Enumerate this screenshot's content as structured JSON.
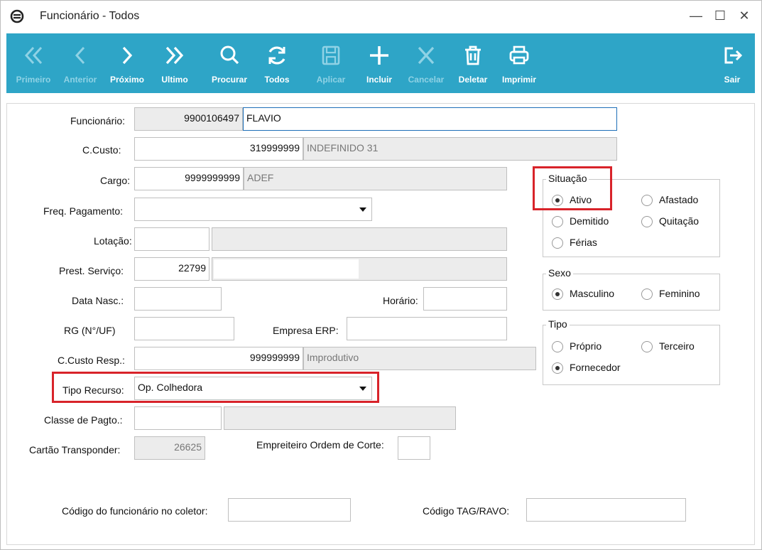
{
  "window": {
    "title": "Funcionário - Todos",
    "minimize": "—",
    "maximize": "☐",
    "close": "✕"
  },
  "toolbar": {
    "first": "Primeiro",
    "previous": "Anterior",
    "next": "Próximo",
    "last": "Ultimo",
    "search": "Procurar",
    "all": "Todos",
    "apply": "Aplicar",
    "add": "Incluir",
    "cancel": "Cancelar",
    "delete": "Deletar",
    "print": "Imprimir",
    "exit": "Sair"
  },
  "form": {
    "funcionario": {
      "label": "Funcionário:",
      "code": "9900106497",
      "name": "FLAVIO"
    },
    "ccusto": {
      "label": "C.Custo:",
      "code": "319999999",
      "desc": "INDEFINIDO 31"
    },
    "cargo": {
      "label": "Cargo:",
      "code": "9999999999",
      "desc": "ADEF"
    },
    "freq_pagamento": {
      "label": "Freq. Pagamento:",
      "value": ""
    },
    "lotacao": {
      "label": "Lotação:",
      "code": "",
      "desc": ""
    },
    "prest_servico": {
      "label": "Prest. Serviço:",
      "code": "22799",
      "desc": ""
    },
    "data_nasc": {
      "label": "Data Nasc.:",
      "value": ""
    },
    "horario": {
      "label": "Horário:",
      "value": ""
    },
    "rg": {
      "label": "RG (N°/UF)",
      "value": ""
    },
    "empresa_erp": {
      "label": "Empresa ERP:",
      "value": ""
    },
    "ccusto_resp": {
      "label": "C.Custo Resp.:",
      "code": "999999999",
      "desc": "Improdutivo"
    },
    "tipo_recurso": {
      "label": "Tipo Recurso:",
      "value": "Op. Colhedora"
    },
    "classe_pagto": {
      "label": "Classe de Pagto.:",
      "code": "",
      "desc": ""
    },
    "cartao_transponder": {
      "label": "Cartão Transponder:",
      "value": "26625"
    },
    "empreiteiro": {
      "label": "Empreiteiro Ordem de Corte:",
      "value": ""
    },
    "codigo_coletor": {
      "label": "Código do funcionário no coletor:",
      "value": ""
    },
    "codigo_tag": {
      "label": "Código TAG/RAVO:",
      "value": ""
    }
  },
  "situacao": {
    "title": "Situação",
    "options": [
      "Ativo",
      "Afastado",
      "Demitido",
      "Quitação",
      "Férias"
    ],
    "selected": "Ativo"
  },
  "sexo": {
    "title": "Sexo",
    "options": [
      "Masculino",
      "Feminino"
    ],
    "selected": "Masculino"
  },
  "tipo": {
    "title": "Tipo",
    "options": [
      "Próprio",
      "Terceiro",
      "Fornecedor"
    ],
    "selected": "Fornecedor"
  },
  "colors": {
    "toolbar": "#2ea5c7",
    "highlight": "#d8232a"
  }
}
